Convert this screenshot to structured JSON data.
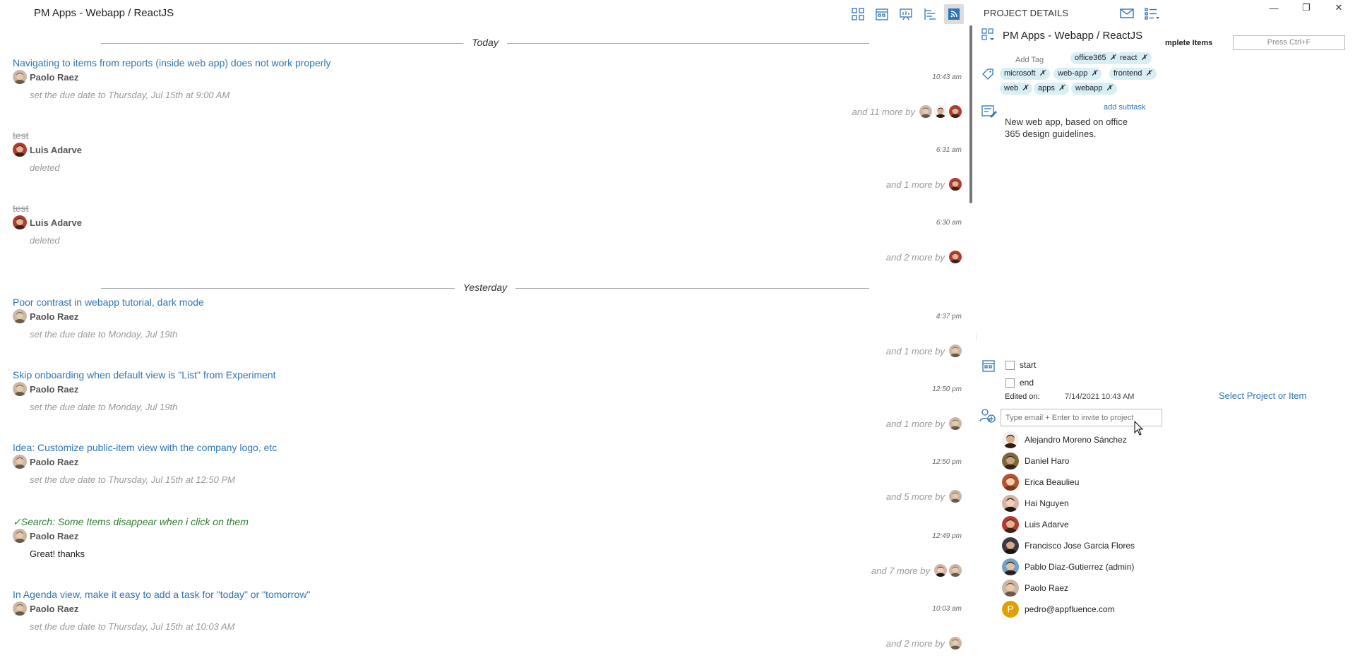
{
  "app_title": "PM Apps - Webapp / ReactJS",
  "toolbar": {
    "buttons": [
      {
        "icon": "grid-view-icon"
      },
      {
        "icon": "calendar-view-icon"
      },
      {
        "icon": "board-view-icon"
      },
      {
        "icon": "gantt-view-icon"
      },
      {
        "icon": "activity-feed-icon",
        "active": true
      }
    ]
  },
  "feed": {
    "dividers": {
      "today": "Today",
      "yesterday": "Yesterday"
    },
    "items": [
      {
        "title": "Navigating to items from reports (inside web app) does not work properly",
        "user": "Paolo Raez",
        "time": "10:43 am",
        "desc": "set the due date to Thursday, Jul 15th at 9:00 AM",
        "more": "and 11 more by"
      },
      {
        "title": "test",
        "user": "Luis Adarve",
        "time": "6:31 am",
        "desc": "deleted",
        "more": "and 1 more by"
      },
      {
        "title": "test",
        "user": "Luis Adarve",
        "time": "6:30 am",
        "desc": "deleted",
        "more": "and 2 more by"
      },
      {
        "title": "Poor contrast in webapp tutorial, dark mode",
        "user": "Paolo Raez",
        "time": "4:37 pm",
        "desc": "set the due date to Monday, Jul 19th",
        "more": "and 1 more by"
      },
      {
        "title": "Skip onboarding when default view is \"List\" from Experiment",
        "user": "Paolo Raez",
        "time": "12:50 pm",
        "desc": "set the due date to Monday, Jul 19th",
        "more": "and 1 more by"
      },
      {
        "title": "Idea: Customize public-item view with the company logo, etc",
        "user": "Paolo Raez",
        "time": "12:50 pm",
        "desc": "set the due date to Thursday, Jul 15th at 12:50 PM",
        "more": "and 5 more by"
      },
      {
        "title": "✓Search: Some Items disappear when i click on them",
        "user": "Paolo Raez",
        "time": "12:49 pm",
        "desc": "Great! thanks",
        "more": "and 7 more by"
      },
      {
        "title": "In Agenda view, make it easy to add a task for \"today\" or \"tomorrow\"",
        "user": "Paolo Raez",
        "time": "10:03 am",
        "desc": "set the due date to Thursday, Jul 15th at 10:03 AM",
        "more": "and 2 more by"
      }
    ]
  },
  "details": {
    "header": "PROJECT DETAILS",
    "project_name": "PM Apps - Webapp / ReactJS",
    "add_tag": "Add Tag",
    "tags": [
      "office365",
      "react",
      "microsoft",
      "web-app",
      "frontend",
      "web",
      "apps",
      "webapp"
    ],
    "tag_remove_glyph": "✗",
    "add_subtask": "add subtask",
    "description": "New web app, based on office 365 design guidelines.",
    "start_label": "start",
    "end_label": "end",
    "edited_label": "Edited on:",
    "edited_value": "7/14/2021 10:43 AM",
    "invite_placeholder": "Type email + Enter to invite to project",
    "members": [
      "Alejandro Moreno Sánchez",
      "Daniel Haro",
      "Erica Beaulieu",
      "Hai Nguyen",
      "Luis Adarve",
      "Francisco Jose Garcia Flores",
      "Pablo Diaz-Gutierrez (admin)",
      "Paolo Raez",
      "pedro@appfluence.com"
    ],
    "member_initial": "P"
  },
  "right_window": {
    "complete_items": "mplete Items",
    "search_placeholder": "Press Ctrl+F",
    "select_prompt": "Select Project or Item",
    "minimize": "—",
    "restore": "❐",
    "close": "✕"
  },
  "colors": {
    "accent": "#2e75b6",
    "done": "#2e7d32",
    "tag_bg": "#d7eef5",
    "muted": "#999999"
  }
}
